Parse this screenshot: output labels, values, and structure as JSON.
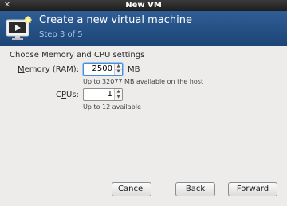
{
  "window": {
    "title": "New VM",
    "close_glyph": "✕"
  },
  "header": {
    "title": "Create a new virtual machine",
    "step": "Step 3 of 5",
    "icon": "vm-monitor-icon"
  },
  "section": {
    "title": "Choose Memory and CPU settings"
  },
  "memory": {
    "label_mnemonic": "M",
    "label_rest": "emory (RAM):",
    "value": "2500",
    "unit": "MB",
    "hint": "Up to 32077 MB available on the host"
  },
  "cpus": {
    "label_pre": "C",
    "label_mnemonic": "P",
    "label_rest": "Us:",
    "value": "1",
    "hint": "Up to 12 available"
  },
  "spin_arrows": {
    "up": "▲",
    "down": "▼"
  },
  "buttons": {
    "cancel": {
      "mnemonic": "C",
      "rest": "ancel"
    },
    "back": {
      "mnemonic": "B",
      "rest": "ack"
    },
    "forward": {
      "mnemonic": "F",
      "rest": "orward"
    }
  },
  "colors": {
    "header": "#1f4a7c",
    "step_text": "#a9c6ea",
    "background": "#edeceb"
  }
}
